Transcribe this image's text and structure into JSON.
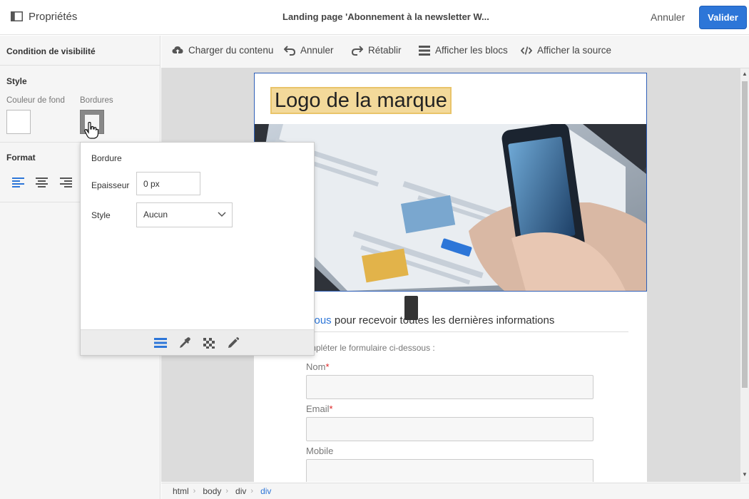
{
  "header": {
    "panel_title": "Propriétés",
    "page_title": "Landing page 'Abonnement à la newsletter W...",
    "cancel_label": "Annuler",
    "validate_label": "Valider"
  },
  "left_panel": {
    "visibility_title": "Condition de visibilité",
    "style_title": "Style",
    "bg_color_label": "Couleur de fond",
    "borders_label": "Bordures",
    "format_title": "Format",
    "align_icons": [
      "align-left-icon",
      "align-center-icon",
      "align-right-icon"
    ]
  },
  "toolbar": {
    "load_content": "Charger du contenu",
    "undo": "Annuler",
    "redo": "Rétablir",
    "show_blocks": "Afficher les blocs",
    "show_source": "Afficher la source"
  },
  "email": {
    "logo_text": "Logo de la marque",
    "headline_link": "vous",
    "headline_rest": " pour recevoir toutes les dernières informations",
    "subtext": "mpléter le formulaire ci-dessous :",
    "fields": [
      {
        "label": "Nom",
        "required": "*"
      },
      {
        "label": "Email",
        "required": "*"
      },
      {
        "label": "Mobile",
        "required": ""
      }
    ]
  },
  "border_popup": {
    "title": "Bordure",
    "thickness_label": "Epaisseur",
    "thickness_value": "0 px",
    "style_label": "Style",
    "style_value": "Aucun",
    "footer_icons": [
      "border-lines-icon",
      "eyedropper-icon",
      "checker-pattern-icon",
      "pencil-icon"
    ]
  },
  "breadcrumb": [
    "html",
    "body",
    "div",
    "div"
  ],
  "colors": {
    "accent": "#2d76d8",
    "logo_highlight": "#f3d99a",
    "panel_bg": "#f5f5f5",
    "canvas_bg": "#dcdcdc"
  }
}
